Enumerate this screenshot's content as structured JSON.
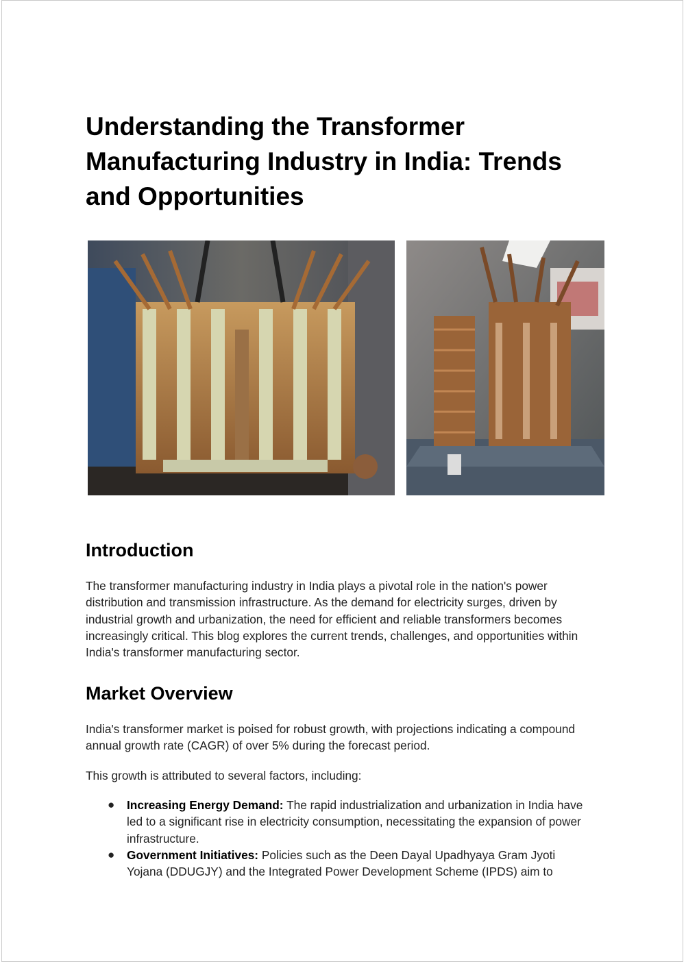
{
  "title": "Understanding the Transformer Manufacturing Industry in India: Trends and Opportunities",
  "images": [
    {
      "name": "transformer-photo-left",
      "alt": "Transformer core and windings"
    },
    {
      "name": "transformer-photo-right",
      "alt": "Transformer windings on base"
    }
  ],
  "intro": {
    "heading": "Introduction",
    "body": "The transformer manufacturing industry in India plays a pivotal role in the nation's power distribution and transmission infrastructure. As the demand for electricity surges, driven by industrial growth and urbanization, the need for efficient and reliable transformers becomes increasingly critical. This blog explores the current trends, challenges, and opportunities within India's transformer manufacturing sector."
  },
  "market": {
    "heading": "Market Overview",
    "para1": "India's transformer market is poised for robust growth, with projections indicating a compound annual growth rate (CAGR) of over 5% during the forecast period.",
    "para2": "This growth is attributed to several factors, including:",
    "items": [
      {
        "bullet": "●",
        "label": "Increasing Energy Demand:",
        "text": " The rapid industrialization and urbanization in India have led to a significant rise in electricity consumption, necessitating the expansion of power infrastructure."
      },
      {
        "bullet": "●",
        "label": "Government Initiatives:",
        "text": " Policies such as the Deen Dayal Upadhyaya Gram Jyoti Yojana (DDUGJY) and the Integrated Power Development Scheme (IPDS) aim to"
      }
    ]
  }
}
